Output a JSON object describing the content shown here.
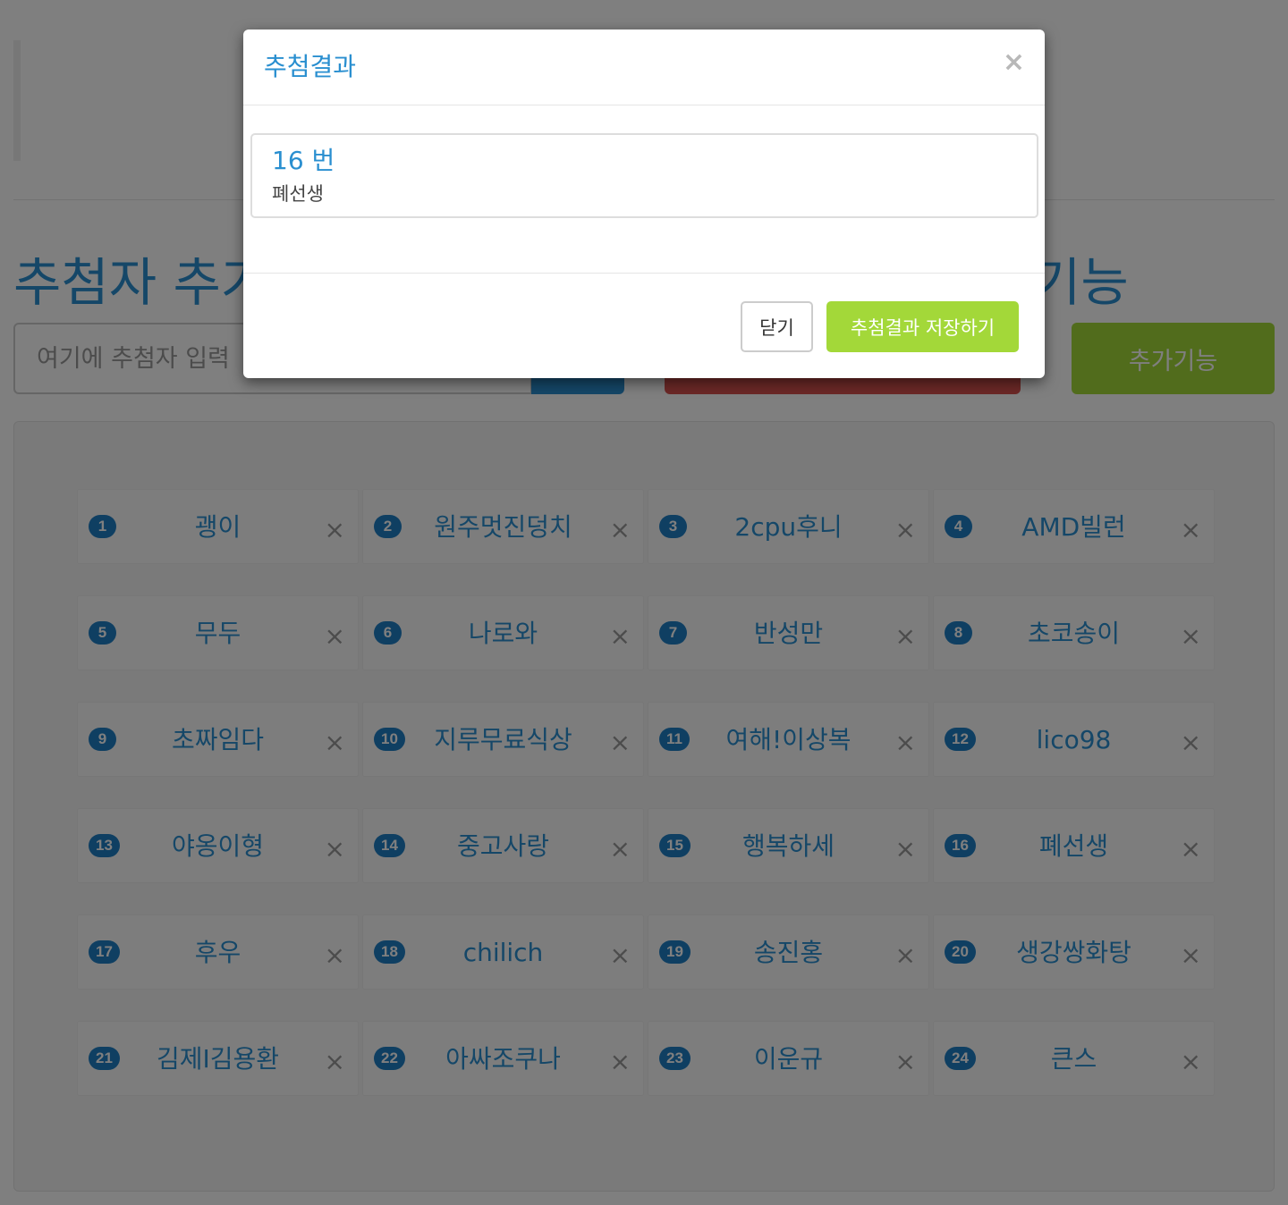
{
  "main": {
    "section_title": "추첨자 추가",
    "section_title_right": "기능",
    "input_placeholder": "여기에 추첨자 입력",
    "extra_button_label": "추가기능"
  },
  "entries": [
    {
      "number": "1",
      "name": "괭이"
    },
    {
      "number": "2",
      "name": "원주멋진덩치"
    },
    {
      "number": "3",
      "name": "2cpu후니"
    },
    {
      "number": "4",
      "name": "AMD빌런"
    },
    {
      "number": "5",
      "name": "무두"
    },
    {
      "number": "6",
      "name": "나로와"
    },
    {
      "number": "7",
      "name": "반성만"
    },
    {
      "number": "8",
      "name": "초코송이"
    },
    {
      "number": "9",
      "name": "초짜임다"
    },
    {
      "number": "10",
      "name": "지루무료식상"
    },
    {
      "number": "11",
      "name": "여해!이상복"
    },
    {
      "number": "12",
      "name": "lico98"
    },
    {
      "number": "13",
      "name": "야옹이형"
    },
    {
      "number": "14",
      "name": "중고사랑"
    },
    {
      "number": "15",
      "name": "행복하세"
    },
    {
      "number": "16",
      "name": "폐선생"
    },
    {
      "number": "17",
      "name": "후우"
    },
    {
      "number": "18",
      "name": "chilich"
    },
    {
      "number": "19",
      "name": "송진홍"
    },
    {
      "number": "20",
      "name": "생강쌍화탕"
    },
    {
      "number": "21",
      "name": "김제I김용환"
    },
    {
      "number": "22",
      "name": "아싸조쿠나"
    },
    {
      "number": "23",
      "name": "이운규"
    },
    {
      "number": "24",
      "name": "큰스"
    }
  ],
  "entry_remove_glyph": "×",
  "modal": {
    "title": "추첨결과",
    "close_glyph": "×",
    "result_number": "16 번",
    "result_name": "폐선생",
    "close_button_label": "닫기",
    "save_button_label": "추첨결과 저장하기"
  },
  "colors": {
    "accent": "#2a8fd0",
    "badge": "#1f7fc4",
    "danger": "#d9534f",
    "success": "#a3d839"
  }
}
